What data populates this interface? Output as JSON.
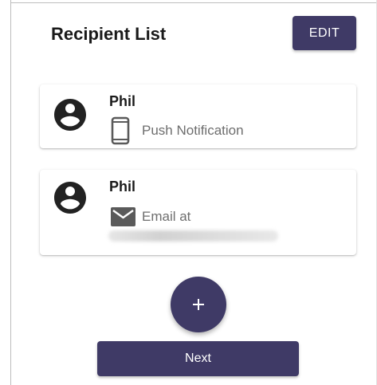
{
  "header": {
    "title": "Recipient List",
    "edit_label": "EDIT"
  },
  "recipients": [
    {
      "name": "Phil",
      "avatar_icon": "account-circle-icon",
      "method_icon": "smartphone-icon",
      "method_text": "Push Notification"
    },
    {
      "name": "Phil",
      "avatar_icon": "account-circle-icon",
      "method_icon": "email-icon",
      "method_text": "Email at",
      "email_redacted": true
    }
  ],
  "actions": {
    "add_icon": "plus-icon",
    "next_label": "Next"
  },
  "colors": {
    "primary": "#3f3a66",
    "text_dark": "#1a1a1a",
    "text_muted": "#6e6e6e",
    "icon_dark": "#222222"
  }
}
